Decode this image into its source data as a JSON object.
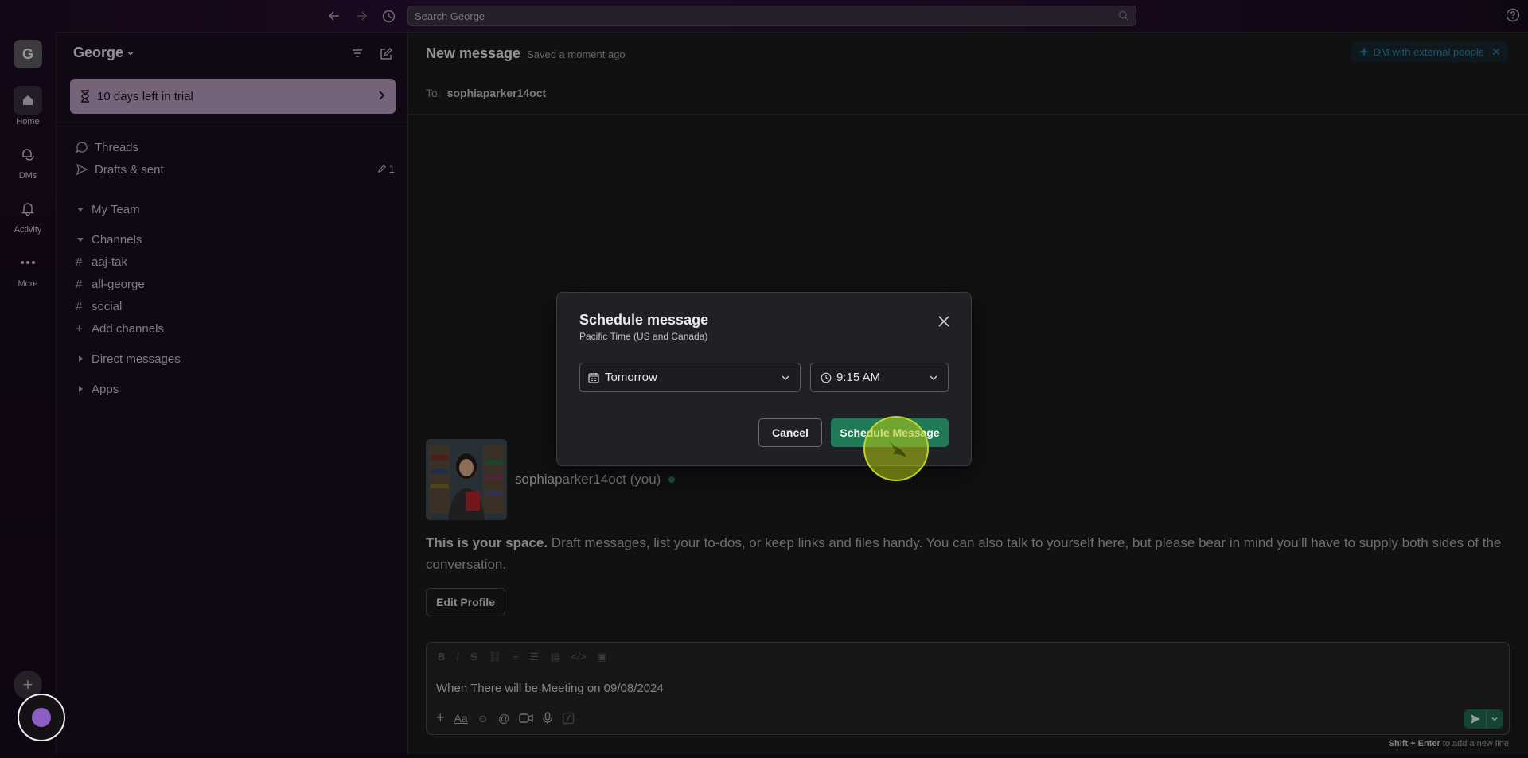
{
  "topbar": {
    "search_placeholder": "Search George"
  },
  "rail": {
    "workspace_initial": "G",
    "items": [
      {
        "label": "Home",
        "icon": "home-icon"
      },
      {
        "label": "DMs",
        "icon": "dms-icon"
      },
      {
        "label": "Activity",
        "icon": "bell-icon"
      },
      {
        "label": "More",
        "icon": "more-icon"
      }
    ]
  },
  "sidebar": {
    "workspace_name": "George",
    "trial_text": "10 days left in trial",
    "threads": "Threads",
    "drafts": "Drafts & sent",
    "drafts_count": "1",
    "my_team": "My Team",
    "channels_header": "Channels",
    "channels": [
      "aaj-tak",
      "all-george",
      "social"
    ],
    "add_channels": "Add channels",
    "direct_messages": "Direct messages",
    "apps": "Apps"
  },
  "main": {
    "title": "New message",
    "saved_status": "Saved a moment ago",
    "dm_external": "DM with external people",
    "to_label": "To:",
    "to_value": "sophiaparker14oct",
    "profile_name": "sophiaparker14oct (you)",
    "space_bold": "This is your space.",
    "space_text": " Draft messages, list your to-dos, or keep links and files handy. You can also talk to yourself here, but please bear in mind you'll have to supply both sides of the conversation.",
    "edit_profile": "Edit Profile",
    "composer_text": "When There will be Meeting on 09/08/2024",
    "hint_keys": "Shift + Enter",
    "hint_text": " to add a new line"
  },
  "modal": {
    "title": "Schedule message",
    "subtitle": "Pacific Time (US and Canada)",
    "date_value": "Tomorrow",
    "time_value": "9:15 AM",
    "cancel_label": "Cancel",
    "schedule_label": "Schedule Message"
  },
  "colors": {
    "accent_green": "#1f7a57",
    "trial_bg": "#b299bb",
    "sidebar_bg": "#1a0d1f"
  }
}
